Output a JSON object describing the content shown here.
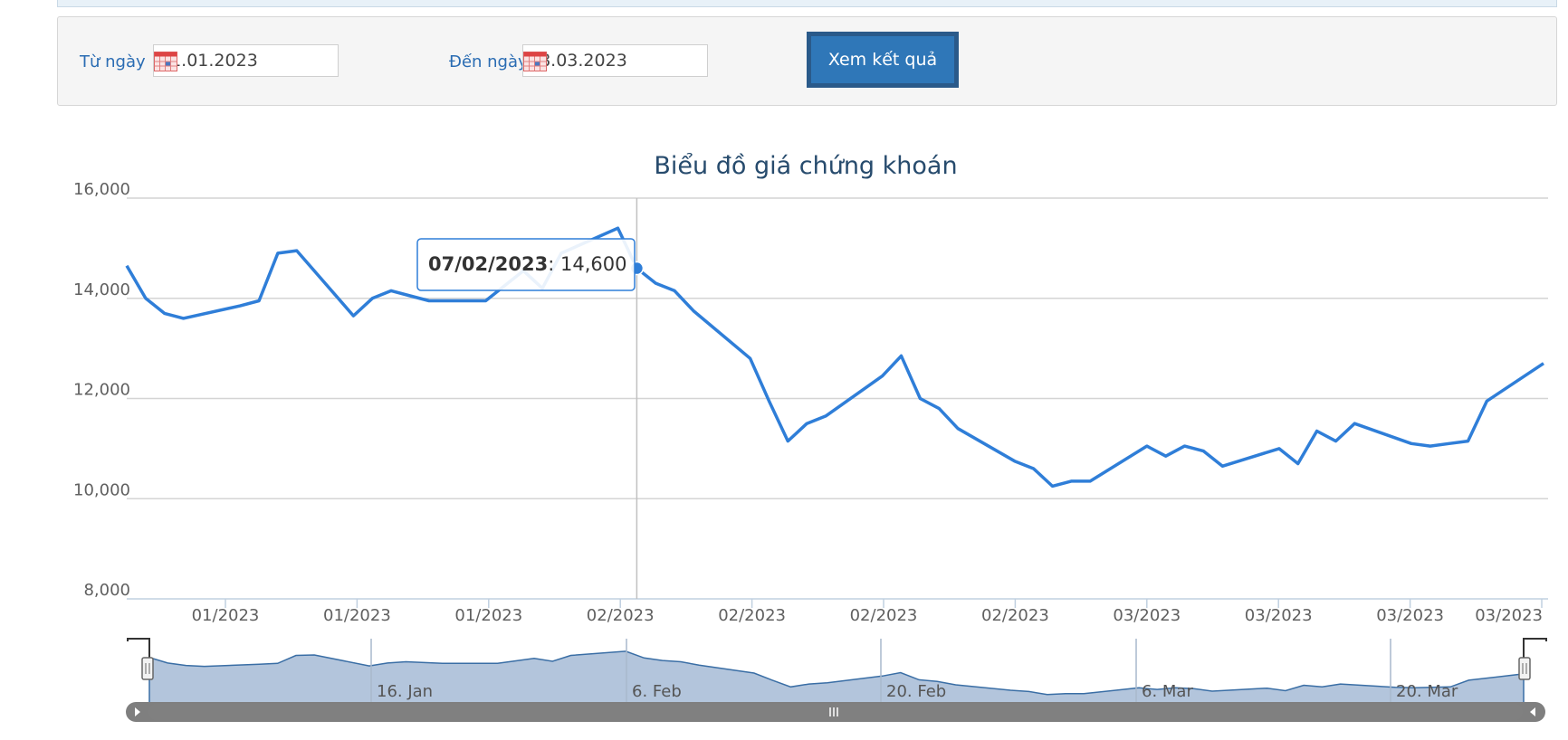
{
  "filter": {
    "from_label": "Từ ngày",
    "from_value": "01.01.2023",
    "to_label": "Đến ngày",
    "to_value": "28.03.2023",
    "submit_label": "Xem kết quả"
  },
  "tooltip": {
    "date": "07/02/2023",
    "value": "14,600"
  },
  "colors": {
    "line": "#2f7ed8",
    "navigator_fill": "#b3c5dc",
    "accent": "#2a6cb3"
  },
  "chart_data": {
    "type": "line",
    "title": "Biểu đồ giá chứng khoán",
    "xlabel": "",
    "ylabel": "",
    "ylim": [
      8000,
      16000
    ],
    "y_ticks": [
      "16,000",
      "14,000",
      "12,000",
      "10,000",
      "8,000"
    ],
    "x_ticks": [
      "01/2023",
      "01/2023",
      "01/2023",
      "02/2023",
      "02/2023",
      "02/2023",
      "02/2023",
      "03/2023",
      "03/2023",
      "03/2023",
      "03/2023"
    ],
    "grid": true,
    "series": [
      {
        "values": [
          [
            12000,
            14650
          ],
          [
            12001,
            14000
          ],
          [
            12002,
            13700
          ],
          [
            12003,
            13600
          ],
          [
            12006,
            13850
          ],
          [
            12007,
            13950
          ],
          [
            12008,
            14900
          ],
          [
            12009,
            14950
          ],
          [
            12012,
            13650
          ],
          [
            12013,
            14000
          ],
          [
            12014,
            14150
          ],
          [
            12015,
            14050
          ],
          [
            12016,
            13950
          ],
          [
            12019,
            13950
          ],
          [
            12020,
            14250
          ],
          [
            12021,
            14550
          ],
          [
            12022,
            14200
          ],
          [
            12023,
            14900
          ],
          [
            12026,
            15400
          ],
          [
            12027,
            14600
          ],
          [
            12028,
            14300
          ],
          [
            12029,
            14150
          ],
          [
            12030,
            13750
          ],
          [
            12033,
            12800
          ],
          [
            12034,
            11950
          ],
          [
            12035,
            11150
          ],
          [
            12036,
            11500
          ],
          [
            12037,
            11650
          ],
          [
            12040,
            12450
          ],
          [
            12041,
            12850
          ],
          [
            12042,
            12000
          ],
          [
            12043,
            11800
          ],
          [
            12044,
            11400
          ],
          [
            12047,
            10750
          ],
          [
            12048,
            10600
          ],
          [
            12049,
            10250
          ],
          [
            12050,
            10350
          ],
          [
            12051,
            10350
          ],
          [
            12054,
            11050
          ],
          [
            12055,
            10850
          ],
          [
            12056,
            11050
          ],
          [
            12057,
            10950
          ],
          [
            12058,
            10650
          ],
          [
            12061,
            11000
          ],
          [
            12062,
            10700
          ],
          [
            12063,
            11350
          ],
          [
            12064,
            11150
          ],
          [
            12065,
            11500
          ],
          [
            12068,
            11100
          ],
          [
            12069,
            11050
          ],
          [
            12070,
            11100
          ],
          [
            12071,
            11150
          ],
          [
            12072,
            11950
          ],
          [
            12075,
            12700
          ]
        ]
      }
    ],
    "navigator": {
      "labels": [
        "16. Jan",
        "6. Feb",
        "20. Feb",
        "6. Mar",
        "20. Mar"
      ]
    }
  }
}
